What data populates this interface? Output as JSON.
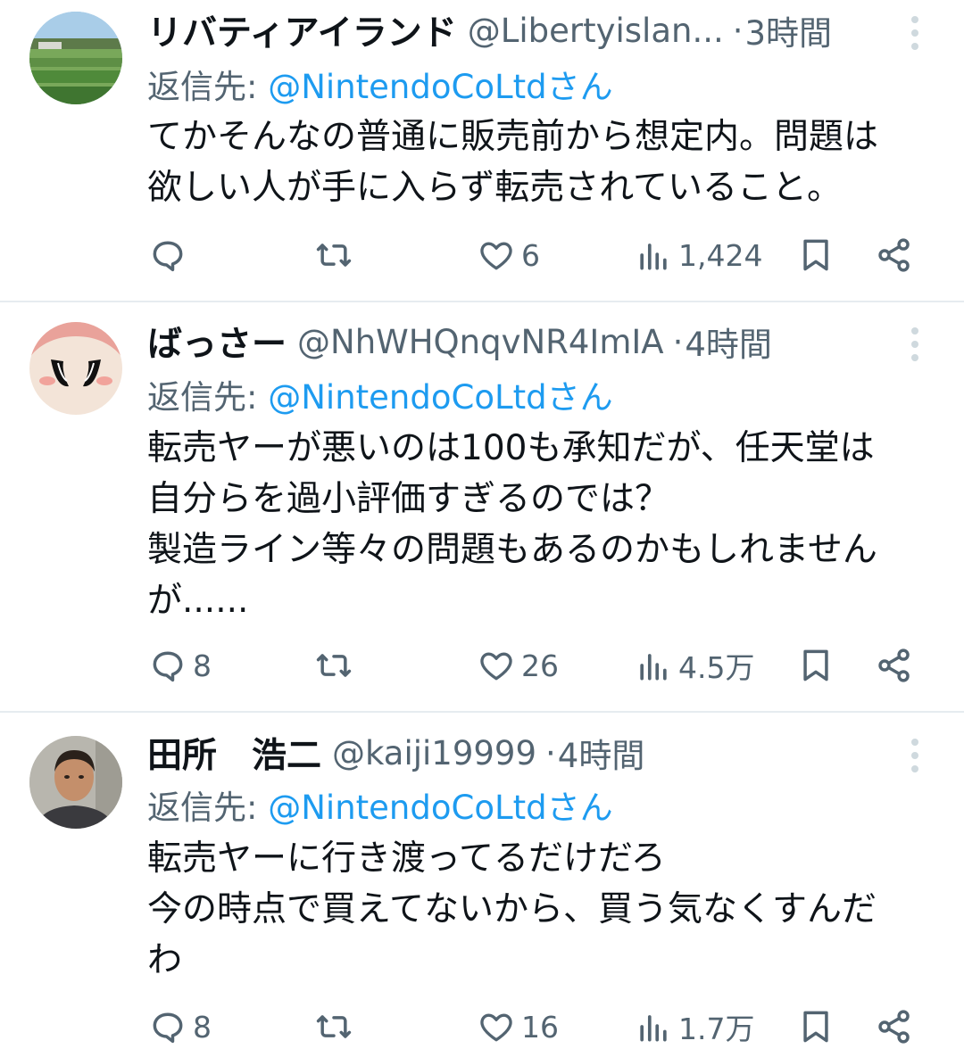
{
  "tweets": [
    {
      "name": "リバティアイランド",
      "handle": "@Libertyislan...",
      "dot": "·",
      "time": "3時間",
      "reply_prefix": "返信先: ",
      "reply_mention": "@NintendoCoLtdさん",
      "body_lines": [
        "てかそんなの普通に販売前から想定内。問題は",
        "欲しい人が手に入らず転売されていること。"
      ],
      "replies": "",
      "retweets": "",
      "likes": "6",
      "views": "1,424"
    },
    {
      "name": "ばっさー",
      "handle": "@NhWHQnqvNR4ImIA",
      "dot": "·",
      "time": "4時間",
      "reply_prefix": "返信先: ",
      "reply_mention": "@NintendoCoLtdさん",
      "body_lines": [
        "転売ヤーが悪いのは100も承知だが、任天堂は",
        "自分らを過小評価すぎるのでは？",
        "製造ライン等々の問題もあるのかもしれません",
        "が......"
      ],
      "replies": "8",
      "retweets": "",
      "likes": "26",
      "views": "4.5万"
    },
    {
      "name": "田所　浩二",
      "handle": "@kaiji19999",
      "dot": "·",
      "time": "4時間",
      "reply_prefix": "返信先: ",
      "reply_mention": "@NintendoCoLtdさん",
      "body_lines": [
        "転売ヤーに行き渡ってるだけだろ",
        "今の時点で買えてないから、買う気なくすんだ",
        "わ"
      ],
      "replies": "8",
      "retweets": "",
      "likes": "16",
      "views": "1.7万"
    }
  ],
  "icons": {
    "reply": "reply-icon",
    "retweet": "retweet-icon",
    "like": "heart-icon",
    "views": "views-icon",
    "bookmark": "bookmark-icon",
    "share": "share-icon",
    "more": "more-icon"
  },
  "colors": {
    "text": "#0f1419",
    "secondary": "#536471",
    "link": "#1d9bf0",
    "divider": "#e6ecf0"
  }
}
